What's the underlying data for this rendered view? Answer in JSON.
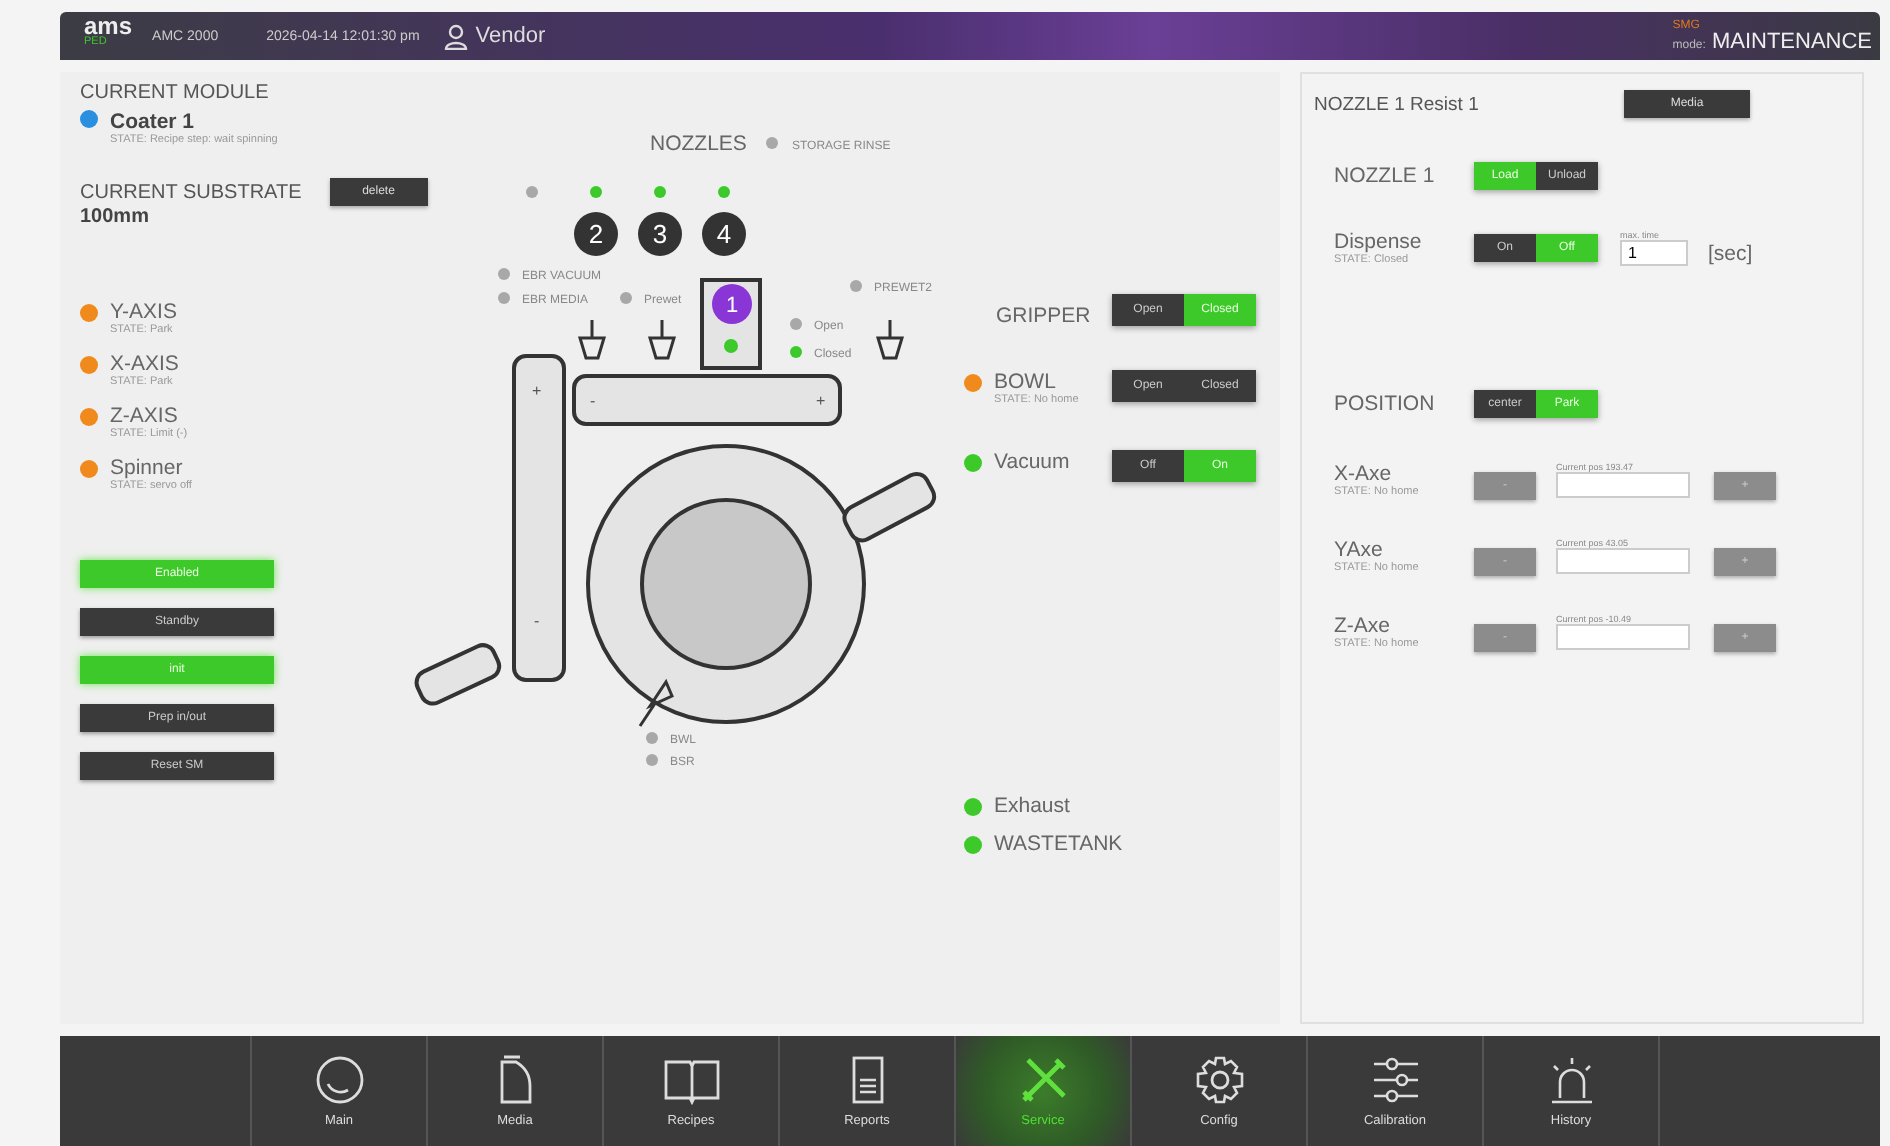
{
  "header": {
    "logo": "ams",
    "logo_sub": "PED",
    "machine": "AMC 2000",
    "datetime": "2026-04-14 12:01:30 pm",
    "user": "Vendor",
    "mode_sub": "SMG",
    "mode_label": "mode:",
    "mode": "MAINTENANCE"
  },
  "module": {
    "heading": "CURRENT MODULE",
    "name": "Coater 1",
    "color": "#2b8fe0",
    "state": "STATE: Recipe step: wait spinning"
  },
  "substrate": {
    "heading": "CURRENT SUBSTRATE",
    "value": "100mm",
    "button": "delete"
  },
  "axes": [
    {
      "name": "Y-AXIS",
      "state": "STATE: Park",
      "color": "#f08a1c"
    },
    {
      "name": "X-AXIS",
      "state": "STATE: Park",
      "color": "#f08a1c"
    },
    {
      "name": "Z-AXIS",
      "state": "STATE: Limit (-)",
      "color": "#f08a1c"
    },
    {
      "name": "Spinner",
      "state": "STATE: servo off",
      "color": "#f08a1c"
    }
  ],
  "mode_buttons": [
    {
      "label": "Enabled",
      "on": true
    },
    {
      "label": "Standby",
      "on": false
    },
    {
      "label": "init",
      "on": true
    },
    {
      "label": "Prep in/out",
      "on": false
    },
    {
      "label": "Reset SM",
      "on": false
    }
  ],
  "diagram": {
    "title": "NOZZLES",
    "storage_rinse": {
      "label": "STORAGE RINSE",
      "on": false
    },
    "nozzle_dots": [
      {
        "on": false
      },
      {
        "on": true
      },
      {
        "on": true
      },
      {
        "on": true
      }
    ],
    "nozzle_numbers": [
      "2",
      "3",
      "4"
    ],
    "active_nozzle": "1",
    "active_nozzle_sensor": {
      "on": true
    },
    "sensors": [
      {
        "label": "EBR VACUUM",
        "on": false
      },
      {
        "label": "EBR MEDIA",
        "on": false
      },
      {
        "label": "Prewet",
        "on": false
      },
      {
        "label": "PREWET2",
        "on": false
      },
      {
        "label": "Open",
        "on": false
      },
      {
        "label": "Closed",
        "on": true
      },
      {
        "label": "BWL",
        "on": false
      },
      {
        "label": "BSR",
        "on": false
      }
    ],
    "horizontal_arm_signs": [
      "-",
      "+"
    ],
    "vertical_arm_signs": [
      "+",
      "-"
    ]
  },
  "controls": [
    {
      "kind": "toggle",
      "label": "GRIPPER",
      "options": [
        {
          "label": "Open",
          "selected": false
        },
        {
          "label": "Closed",
          "selected": true
        }
      ]
    },
    {
      "kind": "status_toggle",
      "label": "BOWL",
      "state": "STATE: No home",
      "color": "#f08a1c",
      "options": [
        {
          "label": "Open",
          "selected": false
        },
        {
          "label": "Closed",
          "selected": false
        }
      ]
    },
    {
      "kind": "status_toggle",
      "label": "Vacuum",
      "color": "#3ec92a",
      "options": [
        {
          "label": "Off",
          "selected": false
        },
        {
          "label": "On",
          "selected": true
        }
      ]
    }
  ],
  "indicators": [
    {
      "label": "Exhaust",
      "color": "#3ec92a"
    },
    {
      "label": "WASTETANK",
      "color": "#3ec92a"
    }
  ],
  "nozzle_panel": {
    "title": "NOZZLE 1 Resist 1",
    "media_button": "Media",
    "nozzle": {
      "label": "NOZZLE 1",
      "options": [
        {
          "label": "Load",
          "selected": true
        },
        {
          "label": "Unload",
          "selected": false
        }
      ]
    },
    "dispense": {
      "label": "Dispense",
      "state": "STATE: Closed",
      "options": [
        {
          "label": "On",
          "selected": false
        },
        {
          "label": "Off",
          "selected": true
        }
      ],
      "max_time_label": "max. time",
      "max_time": "1",
      "unit": "[sec]"
    },
    "position": {
      "label": "POSITION",
      "options": [
        {
          "label": "center",
          "selected": false
        },
        {
          "label": "Park",
          "selected": true
        }
      ]
    },
    "axes": [
      {
        "name": "X-Axe",
        "state": "STATE: No home",
        "current": "Current pos 193.47",
        "minus": "-",
        "plus": "+"
      },
      {
        "name": "YAxe",
        "state": "STATE: No home",
        "current": "Current pos 43.05",
        "minus": "-",
        "plus": "+"
      },
      {
        "name": "Z-Axe",
        "state": "STATE: No home",
        "current": "Current pos -10.49",
        "minus": "-",
        "plus": "+"
      }
    ]
  },
  "nav": [
    {
      "label": "Main",
      "selected": false
    },
    {
      "label": "Media",
      "selected": false
    },
    {
      "label": "Recipes",
      "selected": false
    },
    {
      "label": "Reports",
      "selected": false
    },
    {
      "label": "Service",
      "selected": true
    },
    {
      "label": "Config",
      "selected": false
    },
    {
      "label": "Calibration",
      "selected": false
    },
    {
      "label": "History",
      "selected": false
    }
  ]
}
